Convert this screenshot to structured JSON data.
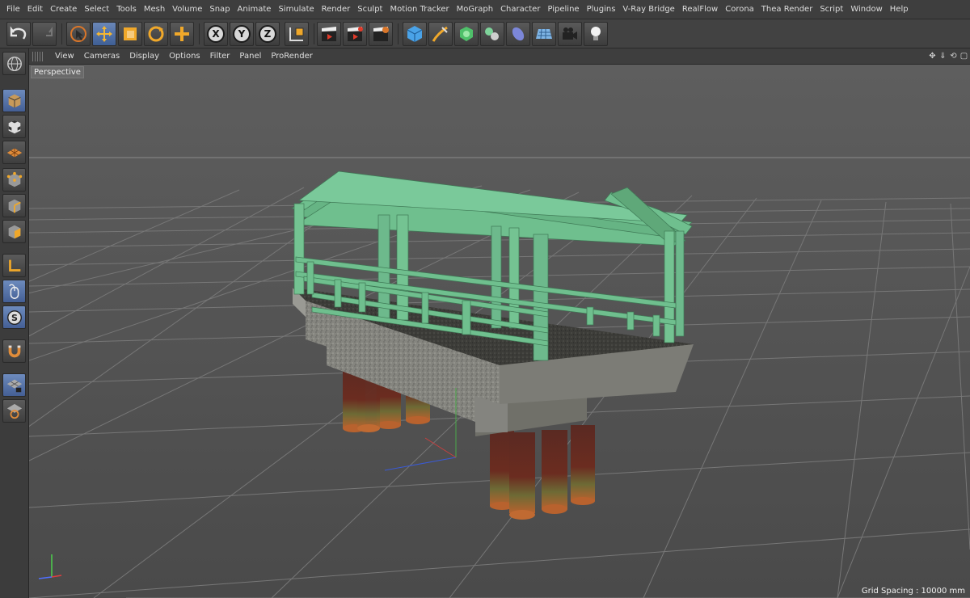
{
  "menu": [
    "File",
    "Edit",
    "Create",
    "Select",
    "Tools",
    "Mesh",
    "Volume",
    "Snap",
    "Animate",
    "Simulate",
    "Render",
    "Sculpt",
    "Motion Tracker",
    "MoGraph",
    "Character",
    "Pipeline",
    "Plugins",
    "V-Ray Bridge",
    "RealFlow",
    "Corona",
    "Thea Render",
    "Script",
    "Window",
    "Help"
  ],
  "toolbar": {
    "x_label": "X",
    "y_label": "Y",
    "z_label": "Z"
  },
  "viewport_menu": [
    "View",
    "Cameras",
    "Display",
    "Options",
    "Filter",
    "Panel",
    "ProRender"
  ],
  "viewport": {
    "label": "Perspective",
    "grid_spacing": "Grid Spacing : 10000 mm"
  },
  "colors": {
    "accent": "#f0a020",
    "active_tool": "#4a6aa0",
    "railing_green": "#6fbf8e",
    "concrete": "#8a8a84",
    "piling": "#6a2f22"
  }
}
